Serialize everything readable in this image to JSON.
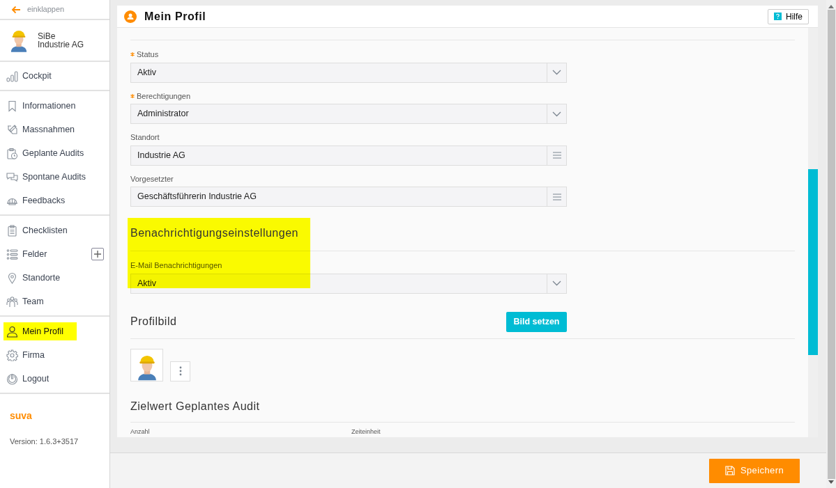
{
  "sidebar": {
    "collapse_label": "einklappen",
    "user": {
      "name": "SiBe",
      "company": "Industrie AG"
    },
    "groups": [
      [
        {
          "label": "Cockpit",
          "selected": false
        }
      ],
      [
        {
          "label": "Informationen",
          "selected": false
        },
        {
          "label": "Massnahmen",
          "selected": false
        },
        {
          "label": "Geplante Audits",
          "selected": false
        },
        {
          "label": "Spontane Audits",
          "selected": false
        },
        {
          "label": "Feedbacks",
          "selected": false
        }
      ],
      [
        {
          "label": "Checklisten",
          "selected": false
        },
        {
          "label": "Felder",
          "selected": false,
          "add_button": true
        },
        {
          "label": "Standorte",
          "selected": false
        },
        {
          "label": "Team",
          "selected": false
        }
      ],
      [
        {
          "label": "Mein Profil",
          "selected": true
        },
        {
          "label": "Firma",
          "selected": false
        },
        {
          "label": "Logout",
          "selected": false
        }
      ]
    ],
    "brand": "suva",
    "version": "Version: 1.6.3+3517"
  },
  "header": {
    "title": "Mein Profil",
    "help_label": "Hilfe"
  },
  "form": {
    "fields": [
      {
        "label": "Status",
        "required": true,
        "value": "Aktiv",
        "kind": "select"
      },
      {
        "label": "Berechtigungen",
        "required": true,
        "value": "Administrator",
        "kind": "select"
      },
      {
        "label": "Standort",
        "required": false,
        "value": "Industrie AG",
        "kind": "list"
      },
      {
        "label": "Vorgesetzter",
        "required": false,
        "value": "Geschäftsführerin  Industrie AG",
        "kind": "list"
      }
    ],
    "notifications": {
      "title": "Benachrichtigungseinstellungen",
      "highlighted": true,
      "fields": [
        {
          "label": "E-Mail Benachrichtigungen",
          "required": false,
          "value": "Aktiv",
          "kind": "select"
        }
      ]
    },
    "profile_picture": {
      "title": "Profilbild",
      "button": "Bild setzen"
    },
    "target": {
      "title": "Zielwert Geplantes Audit",
      "labels": [
        "Anzahl",
        "Zeiteinheit"
      ]
    }
  },
  "footer": {
    "save_label": "Speichern"
  }
}
